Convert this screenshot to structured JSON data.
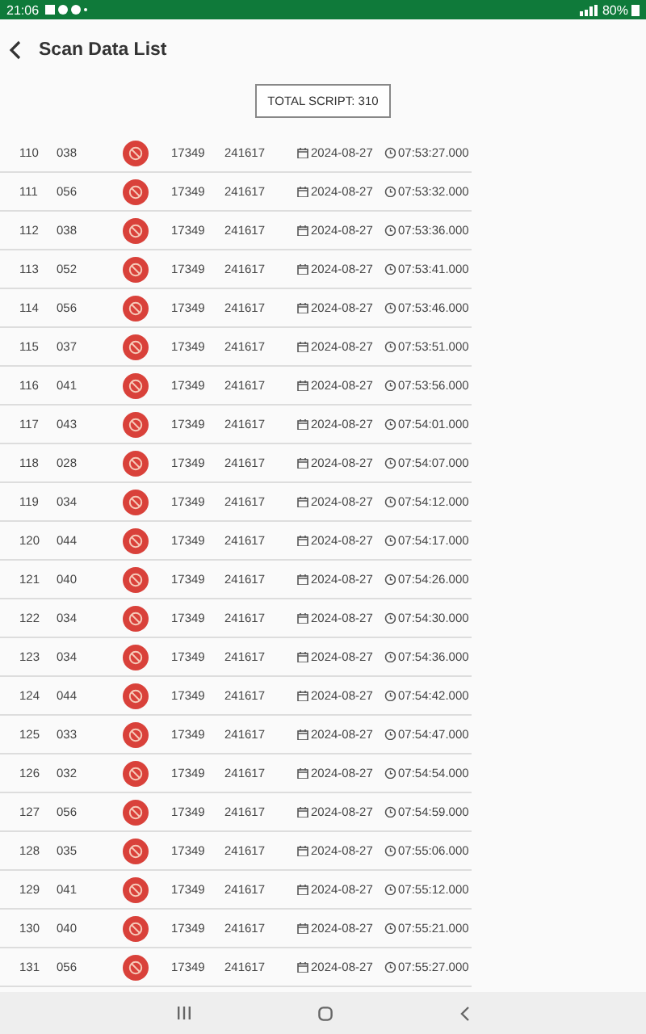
{
  "status_bar": {
    "time": "21:06",
    "battery": "80%"
  },
  "header": {
    "title": "Scan Data List"
  },
  "total": {
    "label": "TOTAL SCRIPT:",
    "value": "310"
  },
  "rows": [
    {
      "index": "110",
      "code": "038",
      "col_3": "17349",
      "col_4": "241617",
      "date": "2024-08-27",
      "time": "07:53:27.000"
    },
    {
      "index": "111",
      "code": "056",
      "col_3": "17349",
      "col_4": "241617",
      "date": "2024-08-27",
      "time": "07:53:32.000"
    },
    {
      "index": "112",
      "code": "038",
      "col_3": "17349",
      "col_4": "241617",
      "date": "2024-08-27",
      "time": "07:53:36.000"
    },
    {
      "index": "113",
      "code": "052",
      "col_3": "17349",
      "col_4": "241617",
      "date": "2024-08-27",
      "time": "07:53:41.000"
    },
    {
      "index": "114",
      "code": "056",
      "col_3": "17349",
      "col_4": "241617",
      "date": "2024-08-27",
      "time": "07:53:46.000"
    },
    {
      "index": "115",
      "code": "037",
      "col_3": "17349",
      "col_4": "241617",
      "date": "2024-08-27",
      "time": "07:53:51.000"
    },
    {
      "index": "116",
      "code": "041",
      "col_3": "17349",
      "col_4": "241617",
      "date": "2024-08-27",
      "time": "07:53:56.000"
    },
    {
      "index": "117",
      "code": "043",
      "col_3": "17349",
      "col_4": "241617",
      "date": "2024-08-27",
      "time": "07:54:01.000"
    },
    {
      "index": "118",
      "code": "028",
      "col_3": "17349",
      "col_4": "241617",
      "date": "2024-08-27",
      "time": "07:54:07.000"
    },
    {
      "index": "119",
      "code": "034",
      "col_3": "17349",
      "col_4": "241617",
      "date": "2024-08-27",
      "time": "07:54:12.000"
    },
    {
      "index": "120",
      "code": "044",
      "col_3": "17349",
      "col_4": "241617",
      "date": "2024-08-27",
      "time": "07:54:17.000"
    },
    {
      "index": "121",
      "code": "040",
      "col_3": "17349",
      "col_4": "241617",
      "date": "2024-08-27",
      "time": "07:54:26.000"
    },
    {
      "index": "122",
      "code": "034",
      "col_3": "17349",
      "col_4": "241617",
      "date": "2024-08-27",
      "time": "07:54:30.000"
    },
    {
      "index": "123",
      "code": "034",
      "col_3": "17349",
      "col_4": "241617",
      "date": "2024-08-27",
      "time": "07:54:36.000"
    },
    {
      "index": "124",
      "code": "044",
      "col_3": "17349",
      "col_4": "241617",
      "date": "2024-08-27",
      "time": "07:54:42.000"
    },
    {
      "index": "125",
      "code": "033",
      "col_3": "17349",
      "col_4": "241617",
      "date": "2024-08-27",
      "time": "07:54:47.000"
    },
    {
      "index": "126",
      "code": "032",
      "col_3": "17349",
      "col_4": "241617",
      "date": "2024-08-27",
      "time": "07:54:54.000"
    },
    {
      "index": "127",
      "code": "056",
      "col_3": "17349",
      "col_4": "241617",
      "date": "2024-08-27",
      "time": "07:54:59.000"
    },
    {
      "index": "128",
      "code": "035",
      "col_3": "17349",
      "col_4": "241617",
      "date": "2024-08-27",
      "time": "07:55:06.000"
    },
    {
      "index": "129",
      "code": "041",
      "col_3": "17349",
      "col_4": "241617",
      "date": "2024-08-27",
      "time": "07:55:12.000"
    },
    {
      "index": "130",
      "code": "040",
      "col_3": "17349",
      "col_4": "241617",
      "date": "2024-08-27",
      "time": "07:55:21.000"
    },
    {
      "index": "131",
      "code": "056",
      "col_3": "17349",
      "col_4": "241617",
      "date": "2024-08-27",
      "time": "07:55:27.000"
    }
  ]
}
